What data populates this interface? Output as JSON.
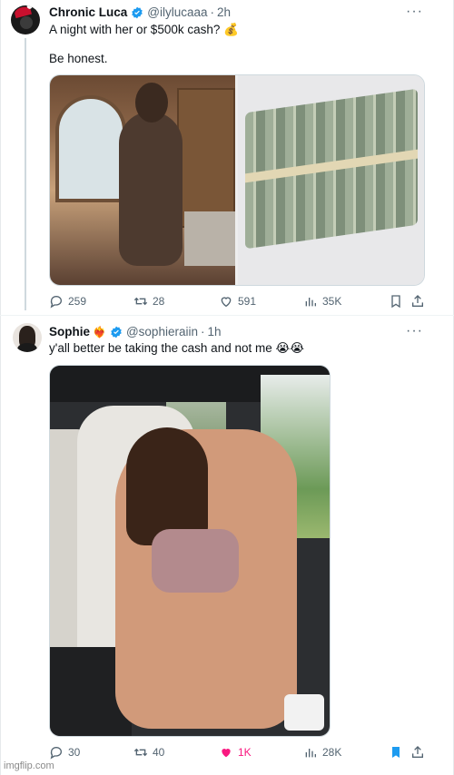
{
  "tweet1": {
    "name": "Chronic Luca",
    "handle": "@ilylucaaa",
    "separator": "·",
    "time": "2h",
    "line1": "A night with her or $500k cash? 💰",
    "line2": "Be honest.",
    "stats": {
      "replies": "259",
      "retweets": "28",
      "likes": "591",
      "views": "35K"
    }
  },
  "tweet2": {
    "name": "Sophie",
    "name_emoji": "❤️‍🔥",
    "handle": "@sophieraiin",
    "separator": "·",
    "time": "1h",
    "text": "y'all better be taking the cash and not me 😭😭",
    "stats": {
      "replies": "30",
      "retweets": "40",
      "likes": "1K",
      "views": "28K"
    }
  },
  "more_label": "···",
  "watermark": "imgflip.com",
  "colors": {
    "verified": "#1d9bf0",
    "like_active": "#f91880",
    "bookmark_active": "#1d9bf0",
    "muted": "#536471"
  }
}
